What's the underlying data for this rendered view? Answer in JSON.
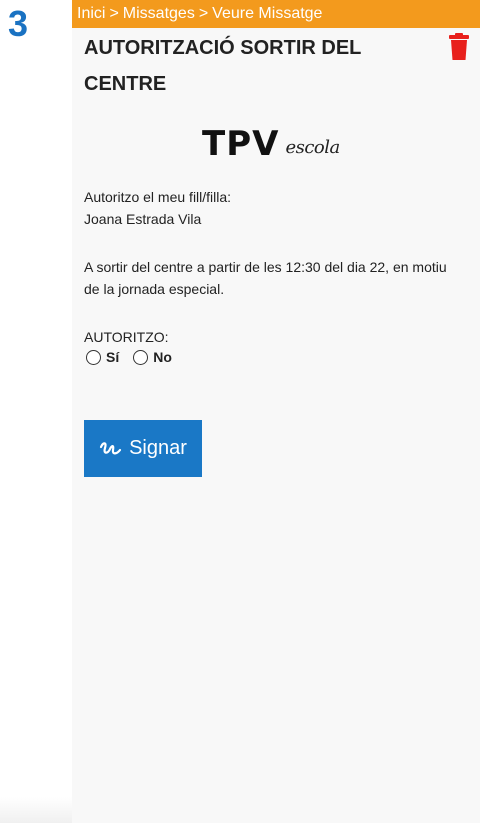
{
  "step": {
    "number": "3"
  },
  "breadcrumb": {
    "items": [
      "Inici",
      "Missatges",
      "Veure Missatge"
    ],
    "separator": ">"
  },
  "message": {
    "title": "AUTORITZACIÓ SORTIR DEL CENTRE",
    "logo": {
      "main": "TPV",
      "sub": "escola"
    },
    "lines": [
      "Autoritzo el meu fill/filla:",
      "Joana Estrada Vila",
      "A sortir del centre a partir de les 12:30 del dia 22, en motiu de la jornada especial.",
      "AUTORITZO:"
    ],
    "options": [
      "Sí",
      "No"
    ],
    "sign_button": "Signar"
  },
  "icons": {
    "delete": "trash-icon",
    "sign": "signature-icon"
  },
  "colors": {
    "breadcrumb_bg": "#f39a1d",
    "button_bg": "#1a78c6",
    "delete_icon": "#e8201c",
    "step_number": "#1a72c2"
  }
}
